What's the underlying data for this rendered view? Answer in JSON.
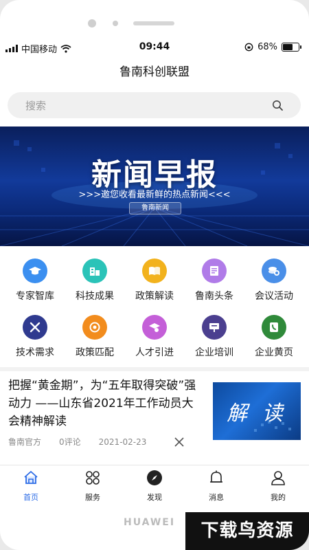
{
  "status": {
    "carrier": "中国移动",
    "time": "09:44",
    "battery": "68%",
    "battery_level": 0.68
  },
  "app": {
    "title": "鲁南科创联盟"
  },
  "search": {
    "placeholder": "搜索"
  },
  "banner": {
    "title": "新闻早报",
    "subtitle": ">>>邀您收看最新鲜的热点新闻<<<",
    "tag": "鲁南新闻",
    "slide_count": 2,
    "active_slide": 1
  },
  "menu": {
    "items": [
      {
        "label": "专家智库",
        "icon": "graduation-cap-icon",
        "color": "#3b8ff0"
      },
      {
        "label": "科技成果",
        "icon": "building-icon",
        "color": "#2bc3b8"
      },
      {
        "label": "政策解读",
        "icon": "book-icon",
        "color": "#f2b21d"
      },
      {
        "label": "鲁南头条",
        "icon": "newspaper-icon",
        "color": "#b07be8"
      },
      {
        "label": "会议活动",
        "icon": "coins-icon",
        "color": "#4a8fe8"
      },
      {
        "label": "技术需求",
        "icon": "tools-icon",
        "color": "#2f3a8f"
      },
      {
        "label": "政策匹配",
        "icon": "target-icon",
        "color": "#f28c1d"
      },
      {
        "label": "人才引进",
        "icon": "mortarboard-icon",
        "color": "#c45fd8"
      },
      {
        "label": "企业培训",
        "icon": "presentation-icon",
        "color": "#4b3f8f"
      },
      {
        "label": "企业黄页",
        "icon": "phone-book-icon",
        "color": "#2f8a3a"
      }
    ]
  },
  "news": {
    "title": "把握“黄金期”，为“五年取得突破”强动力 ——山东省2021年工作动员大会精神解读",
    "image_text": "解 读",
    "source": "鲁南官方",
    "comments": "0评论",
    "date": "2021-02-23"
  },
  "tabs": [
    {
      "label": "首页",
      "icon": "home-icon"
    },
    {
      "label": "服务",
      "icon": "services-icon"
    },
    {
      "label": "发现",
      "icon": "compass-icon"
    },
    {
      "label": "消息",
      "icon": "bell-icon"
    },
    {
      "label": "我的",
      "icon": "user-icon"
    }
  ],
  "colors": {
    "accent": "#2b6be6"
  },
  "device": {
    "brand": "HUAWEI"
  },
  "watermark": {
    "text": "下载鸟资源"
  }
}
